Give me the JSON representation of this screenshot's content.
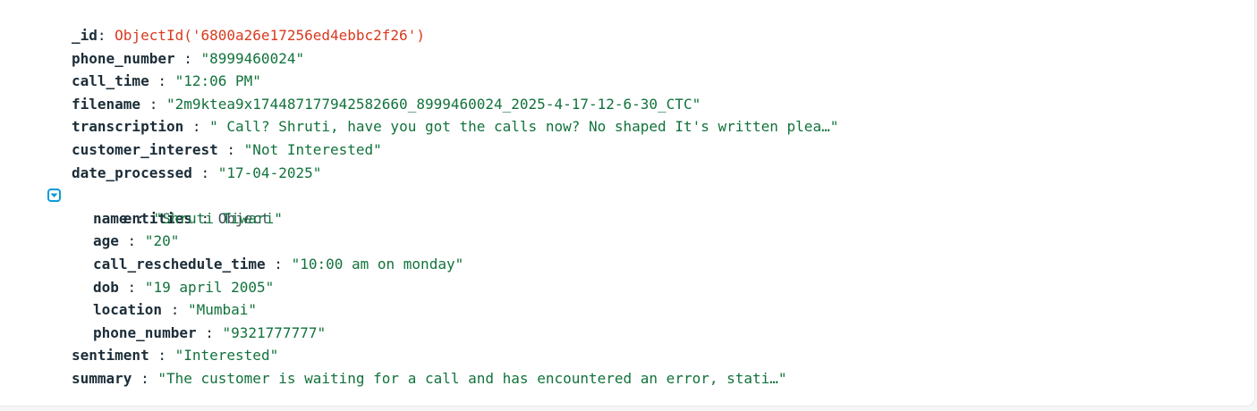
{
  "document": {
    "fields": [
      {
        "key": "_id",
        "sep": ": ",
        "value": "ObjectId('6800a26e17256ed4ebbc2f26')",
        "kind": "oid"
      },
      {
        "key": "phone_number",
        "sep": " : ",
        "value": "\"8999460024\"",
        "kind": "string"
      },
      {
        "key": "call_time",
        "sep": " : ",
        "value": "\"12:06 PM\"",
        "kind": "string"
      },
      {
        "key": "filename",
        "sep": " : ",
        "value": "\"2m9ktea9x17448717794258266​0_8999460024_2025-4-17-12-6-30_CTC\"",
        "kind": "string"
      },
      {
        "key": "transcription",
        "sep": " : ",
        "value": "\" Call? Shruti, have you got the calls now? No shaped It's written plea…\"",
        "kind": "string"
      },
      {
        "key": "customer_interest",
        "sep": " : ",
        "value": "\"Not Interested\"",
        "kind": "string"
      },
      {
        "key": "date_processed",
        "sep": " : ",
        "value": "\"17-04-2025\"",
        "kind": "string"
      }
    ],
    "entities": {
      "key": "entities",
      "sep": " : ",
      "type": "Object",
      "toggle_icon": "chevron-down-icon",
      "fields": [
        {
          "key": "name",
          "sep": " : ",
          "value": "\"Shruti Tiwari\""
        },
        {
          "key": "age",
          "sep": " : ",
          "value": "\"20\""
        },
        {
          "key": "call_reschedule_time",
          "sep": " : ",
          "value": "\"10:00 am on monday\""
        },
        {
          "key": "dob",
          "sep": " : ",
          "value": "\"19 april 2005\""
        },
        {
          "key": "location",
          "sep": " : ",
          "value": "\"Mumbai\""
        },
        {
          "key": "phone_number",
          "sep": " : ",
          "value": "\"9321777777\""
        }
      ]
    },
    "trailing_fields": [
      {
        "key": "sentiment",
        "sep": " : ",
        "value": "\"Interested\""
      },
      {
        "key": "summary",
        "sep": " : ",
        "value": "\"The customer is waiting for a call and has encountered an error, stati…\""
      }
    ]
  },
  "colors": {
    "key": "#1c2d38",
    "string": "#12723c",
    "object_id": "#d83a1f",
    "toggle": "#0b9bd8"
  }
}
